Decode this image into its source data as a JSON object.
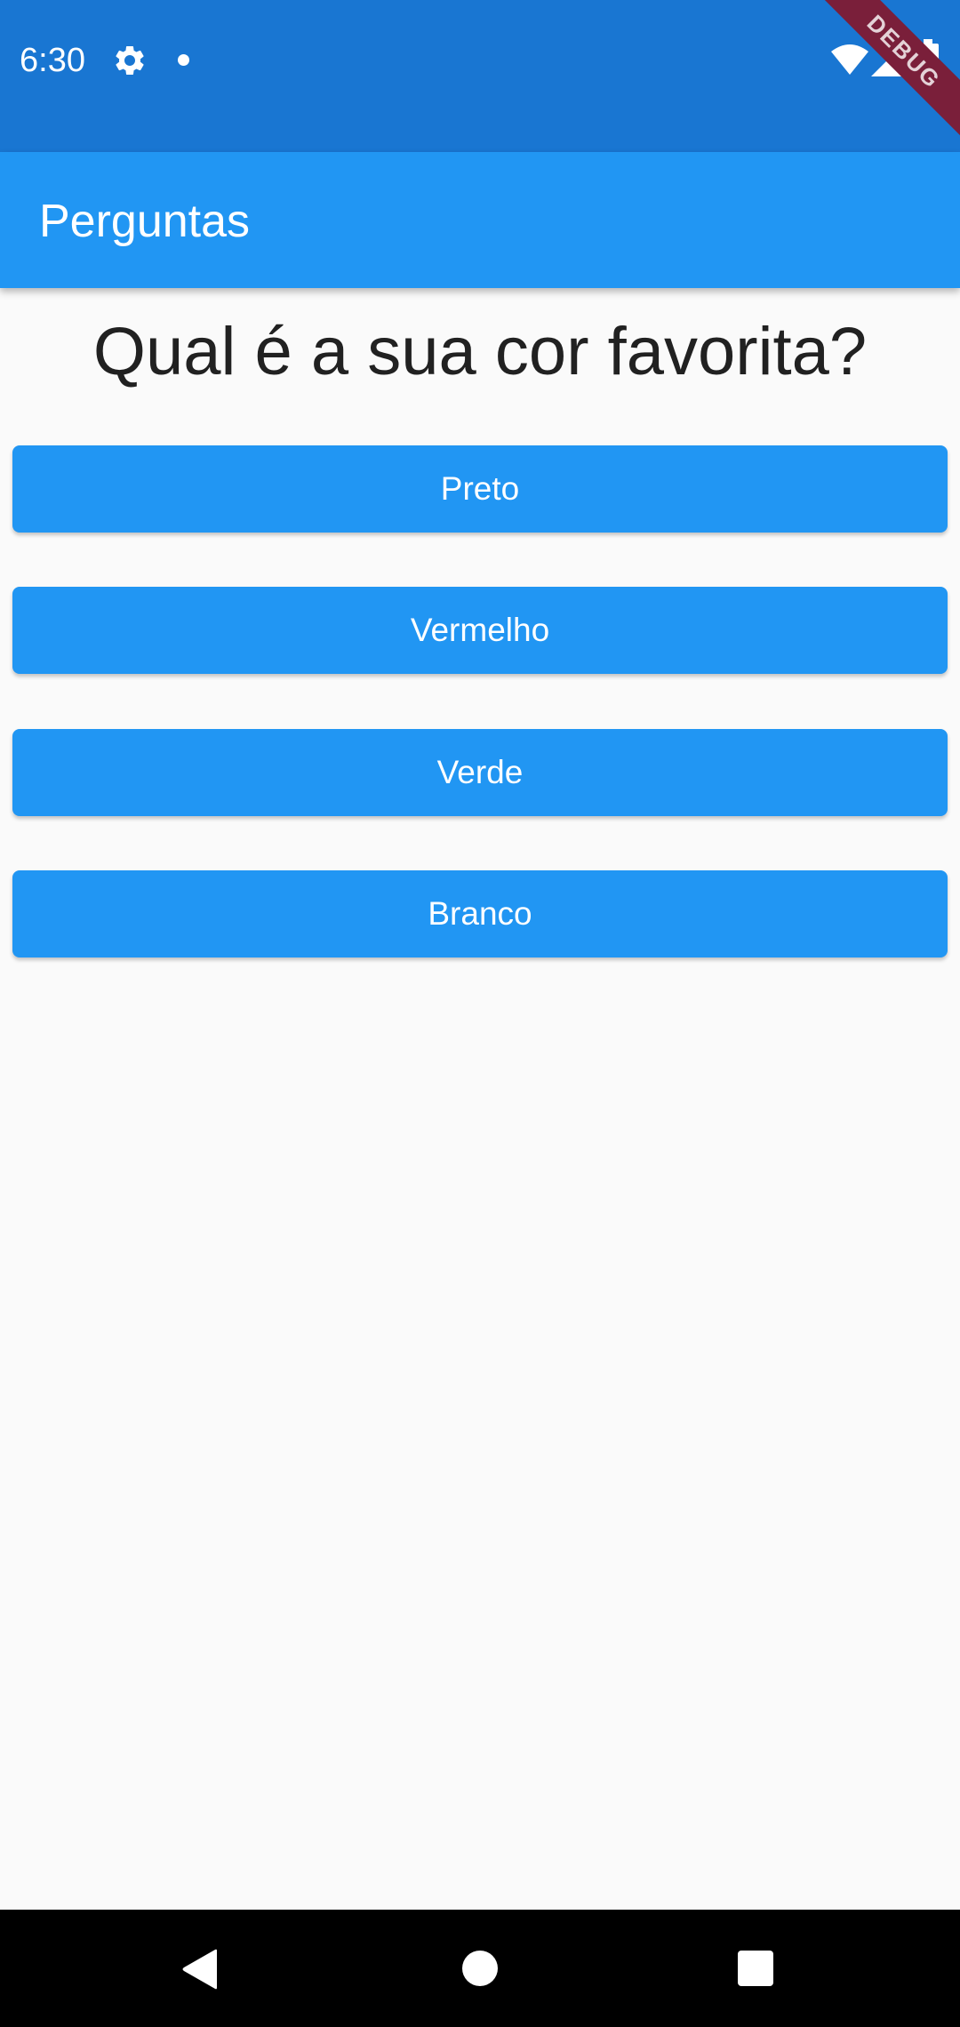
{
  "status_bar": {
    "time": "6:30",
    "icons": [
      "gear-icon",
      "notification-dot-icon",
      "wifi-icon",
      "signal-icon",
      "battery-icon"
    ]
  },
  "debug_banner": {
    "label": "DEBUG"
  },
  "app_bar": {
    "title": "Perguntas"
  },
  "main": {
    "question": "Qual é a sua cor favorita?",
    "answers": [
      {
        "label": "Preto"
      },
      {
        "label": "Vermelho"
      },
      {
        "label": "Verde"
      },
      {
        "label": "Branco"
      }
    ]
  },
  "nav_bar": {
    "icons": [
      "back-icon",
      "home-icon",
      "recents-icon"
    ]
  },
  "colors": {
    "status_bar": "#1976d2",
    "app_bar": "#2196f3",
    "button": "#2196f3",
    "button_text": "#ffffff",
    "background": "#fafafa",
    "question_text": "#212121",
    "nav_bar": "#000000"
  }
}
